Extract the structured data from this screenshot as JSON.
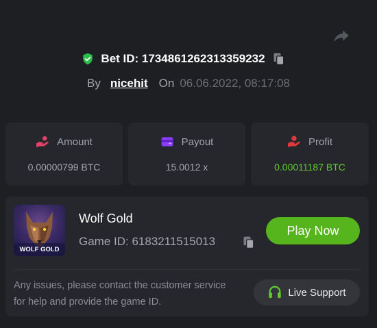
{
  "header": {
    "bet_label": "Bet ID: 1734861262313359232",
    "by_label": "By",
    "username": "nicehit",
    "on_label": "On",
    "date": "06.06.2022, 08:17:08"
  },
  "stats": [
    {
      "label": "Amount",
      "value": "0.00000799 BTC",
      "icon": "hand-coins-icon"
    },
    {
      "label": "Payout",
      "value": "15.0012 x",
      "icon": "wallet-icon"
    },
    {
      "label": "Profit",
      "value": "0.00011187 BTC",
      "icon": "hand-profit-icon"
    }
  ],
  "game": {
    "thumb_text": "WOLF GOLD",
    "title": "Wolf Gold",
    "id_label": "Game ID: 6183211515013",
    "play_label": "Play Now",
    "note": "Any issues, please contact the customer service for help and provide the game ID.",
    "support_label": "Live Support"
  },
  "colors": {
    "background": "#1e1f23",
    "card": "#26272c",
    "accent_green": "#56b51c",
    "profit_green": "#5fcc2b",
    "amount_icon": "#e0426a",
    "payout_icon": "#8b3dff",
    "profit_icon": "#e23a3a"
  }
}
